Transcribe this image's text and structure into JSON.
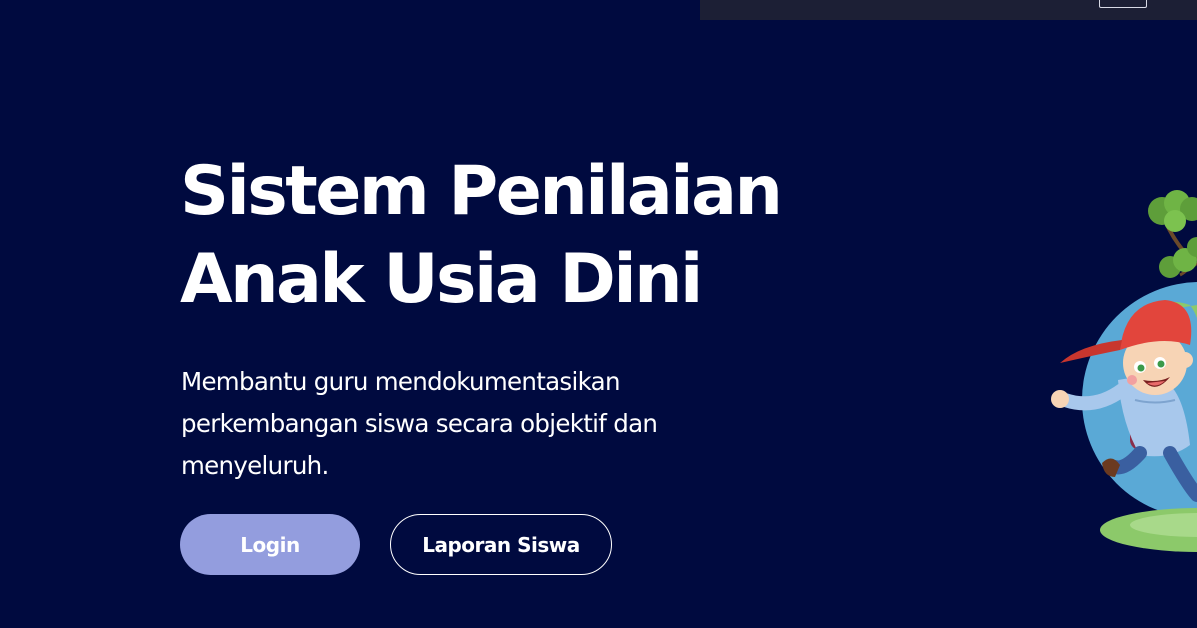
{
  "hero": {
    "title_line1": "Sistem Penilaian",
    "title_line2": "Anak Usia Dini",
    "subtitle": "Membantu guru mendokumentasikan perkembangan siswa secara objektif dan menyeluruh."
  },
  "buttons": {
    "login_label": "Login",
    "report_label": "Laporan Siswa"
  },
  "illustration": {
    "subject": "cartoon-boy-with-red-cap-running-on-globe"
  },
  "colors": {
    "background": "#000a3f",
    "topbar": "#1c1f35",
    "login_button": "#939dde",
    "text": "#ffffff"
  }
}
